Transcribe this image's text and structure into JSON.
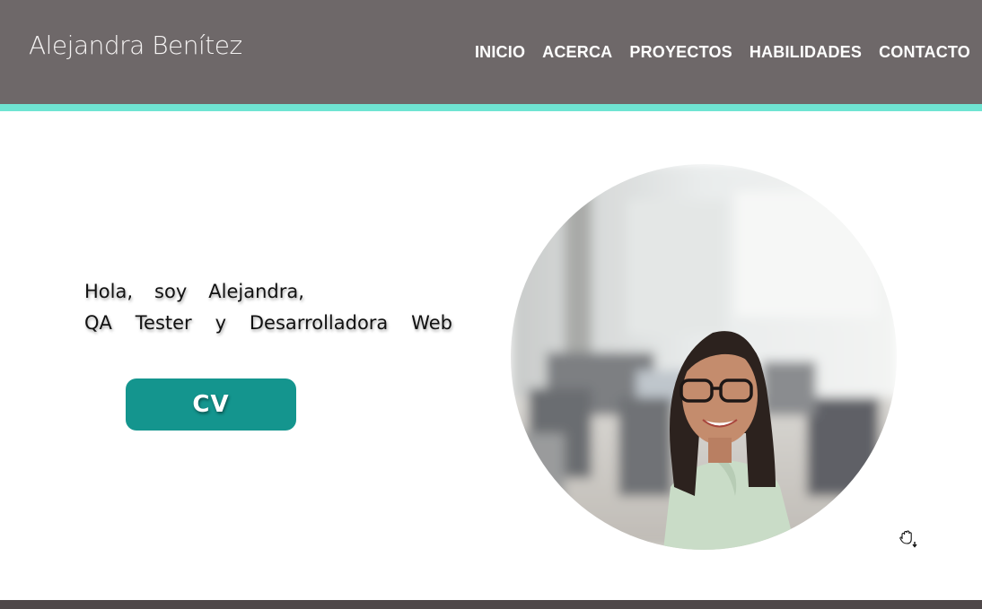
{
  "header": {
    "brand": "Alejandra Benítez",
    "nav": [
      "INICIO",
      "ACERCA",
      "PROYECTOS",
      "HABILIDADES",
      "CONTACTO"
    ]
  },
  "hero": {
    "line1": [
      "Hola,",
      "soy",
      "Alejandra,"
    ],
    "line2": [
      "QA",
      "Tester",
      "y",
      "Desarrolladora",
      "Web"
    ],
    "cv_label": "CV"
  },
  "icons": {
    "cursor": "hand-grab-cursor-icon"
  },
  "colors": {
    "header_bg": "#6e6869",
    "accent": "#6fe4d2",
    "button": "#14958e",
    "footer": "#4f4849"
  }
}
